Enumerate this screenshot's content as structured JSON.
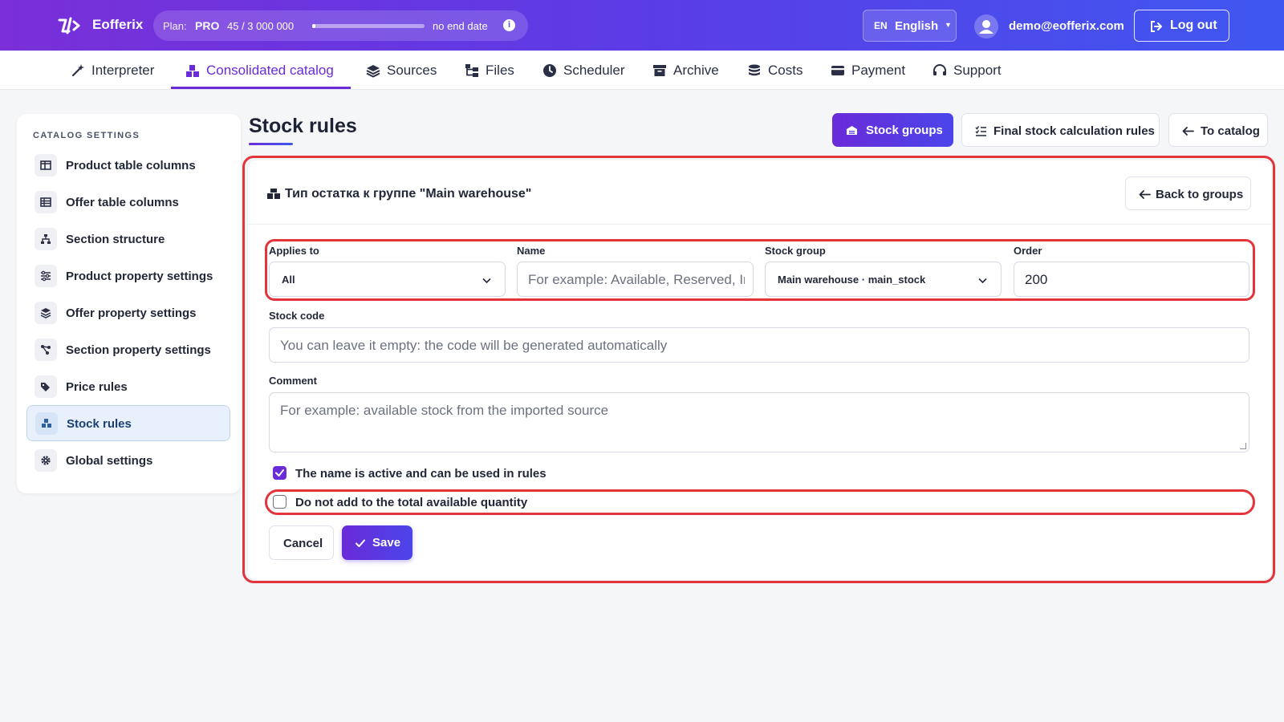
{
  "app": {
    "name": "Eofferix"
  },
  "plan": {
    "label": "Plan:",
    "tier": "PRO",
    "usage": "45 / 3 000 000",
    "usage_fraction": 1.5e-05,
    "end": "no end date"
  },
  "lang": {
    "code": "EN",
    "name": "English"
  },
  "user": {
    "email": "demo@eofferix.com"
  },
  "logout_label": "Log out",
  "nav": [
    {
      "label": "Interpreter",
      "icon": "magic-wand-icon"
    },
    {
      "label": "Consolidated catalog",
      "icon": "cubes-icon",
      "active": true
    },
    {
      "label": "Sources",
      "icon": "layers-icon"
    },
    {
      "label": "Files",
      "icon": "folder-tree-icon"
    },
    {
      "label": "Scheduler",
      "icon": "clock-icon"
    },
    {
      "label": "Archive",
      "icon": "archive-box-icon"
    },
    {
      "label": "Costs",
      "icon": "coins-icon"
    },
    {
      "label": "Payment",
      "icon": "credit-card-icon"
    },
    {
      "label": "Support",
      "icon": "headset-icon"
    }
  ],
  "sidebar": {
    "title": "CATALOG SETTINGS",
    "items": [
      {
        "label": "Product table columns",
        "icon": "columns-icon"
      },
      {
        "label": "Offer table columns",
        "icon": "table-icon"
      },
      {
        "label": "Section structure",
        "icon": "sitemap-icon"
      },
      {
        "label": "Product property settings",
        "icon": "sliders-icon"
      },
      {
        "label": "Offer property settings",
        "icon": "layers-icon"
      },
      {
        "label": "Section property settings",
        "icon": "share-nodes-icon"
      },
      {
        "label": "Price rules",
        "icon": "tags-icon"
      },
      {
        "label": "Stock rules",
        "icon": "cubes-icon",
        "active": true
      },
      {
        "label": "Global settings",
        "icon": "gear-icon"
      }
    ]
  },
  "page": {
    "title": "Stock rules",
    "buttons": {
      "stock_groups": "Stock groups",
      "final_rules": "Final stock calculation rules",
      "to_catalog": "To catalog"
    }
  },
  "form": {
    "title": "Тип остатка к группе \"Main warehouse\"",
    "back_label": "Back to groups",
    "applies_to": {
      "label": "Applies to",
      "value": "All"
    },
    "name": {
      "label": "Name",
      "placeholder": "For example: Available, Reserved, In t"
    },
    "stock_group": {
      "label": "Stock group",
      "value": "Main warehouse · main_stock"
    },
    "order": {
      "label": "Order",
      "value": "200"
    },
    "stock_code": {
      "label": "Stock code",
      "placeholder": "You can leave it empty: the code will be generated automatically"
    },
    "comment": {
      "label": "Comment",
      "placeholder": "For example: available stock from the imported source"
    },
    "active_check": {
      "label": "The name is active and can be used in rules",
      "checked": true
    },
    "exclude_check": {
      "label": "Do not add to the total available quantity",
      "checked": false
    },
    "cancel_label": "Cancel",
    "save_label": "Save"
  },
  "colors": {
    "accent": "#6a2bd8",
    "highlight": "#e3343b"
  }
}
